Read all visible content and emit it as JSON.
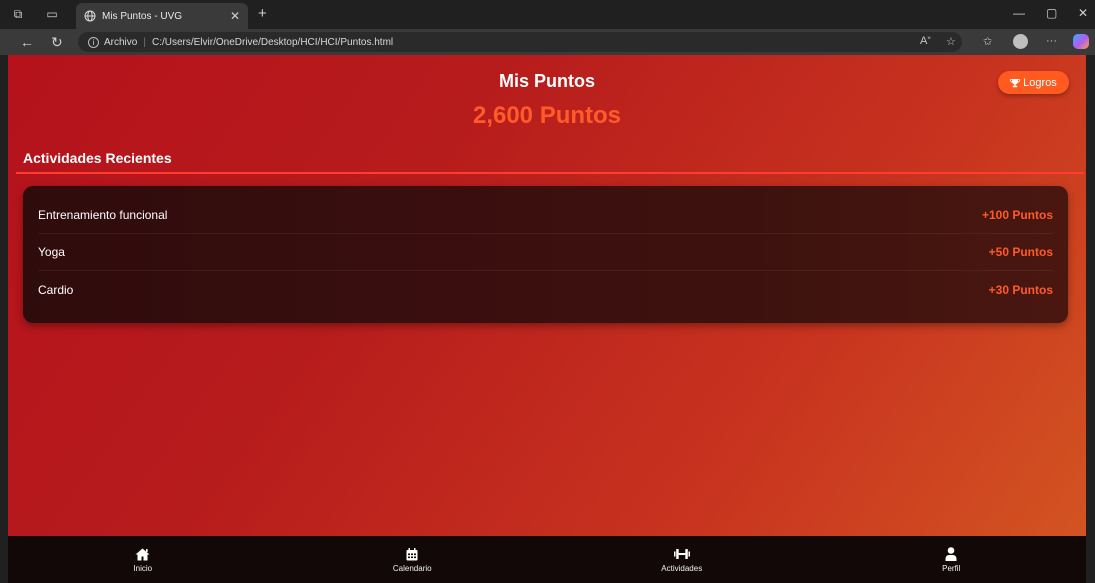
{
  "browser": {
    "tab_title": "Mis Puntos - UVG",
    "url_scheme_label": "Archivo",
    "url": "C:/Users/Elvir/OneDrive/Desktop/HCI/HCI/Puntos.html"
  },
  "header": {
    "title": "Mis Puntos",
    "points_total": "2,600 Puntos",
    "logros_label": "Logros"
  },
  "activities": {
    "section_title": "Actividades Recientes",
    "items": [
      {
        "name": "Entrenamiento funcional",
        "points": "+100 Puntos"
      },
      {
        "name": "Yoga",
        "points": "+50 Puntos"
      },
      {
        "name": "Cardio",
        "points": "+30 Puntos"
      }
    ]
  },
  "bottom_nav": {
    "items": [
      {
        "label": "Inicio",
        "icon": "home-icon"
      },
      {
        "label": "Calendario",
        "icon": "calendar-icon"
      },
      {
        "label": "Actividades",
        "icon": "dumbbell-icon"
      },
      {
        "label": "Perfil",
        "icon": "user-icon"
      }
    ]
  },
  "colors": {
    "accent": "#ff5a2a",
    "background_start": "#b5121c",
    "background_end": "#d45622",
    "card": "#3a0e0e",
    "nav": "#120808"
  }
}
